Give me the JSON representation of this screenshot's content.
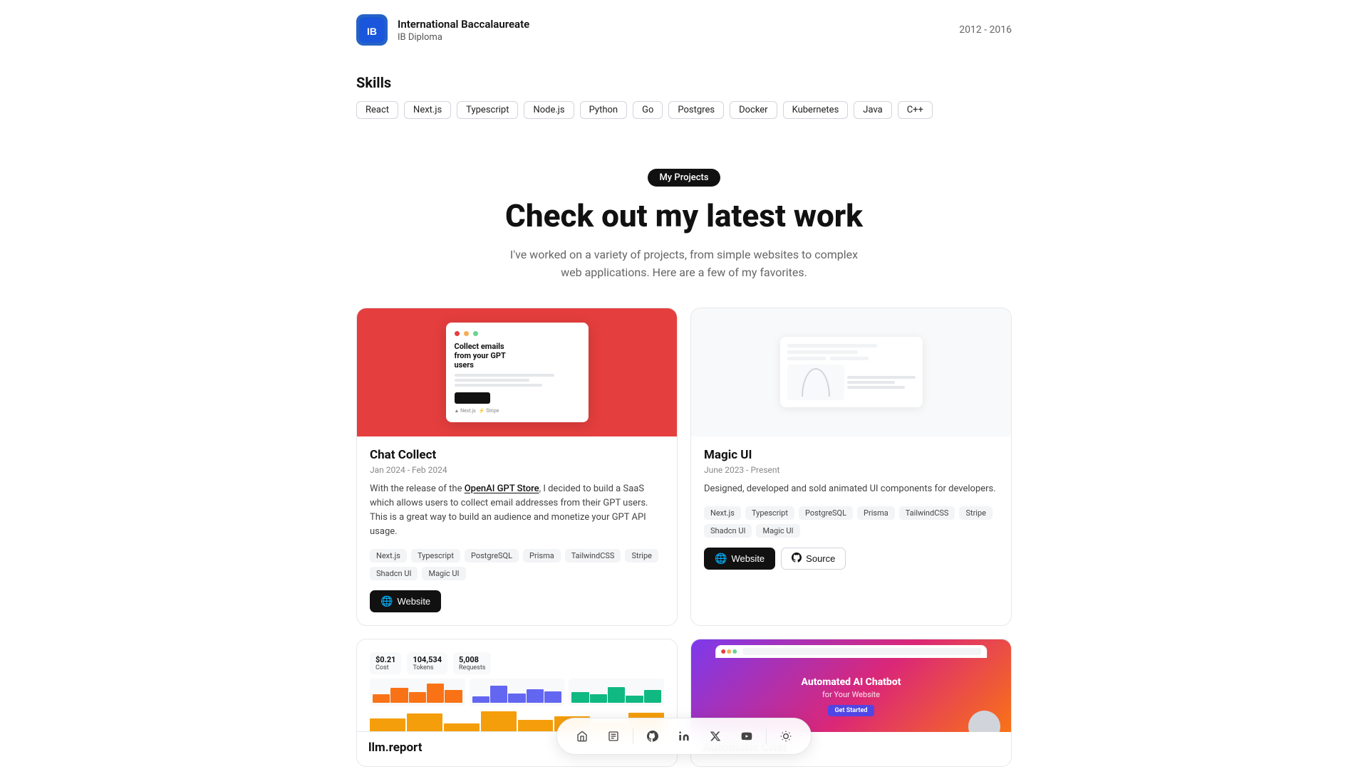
{
  "education": {
    "org_name": "International Baccalaureate",
    "org_short": "IB",
    "degree": "IB Diploma",
    "dates": "2012 - 2016"
  },
  "skills": {
    "section_title": "Skills",
    "tags": [
      "React",
      "Next.js",
      "Typescript",
      "Node.js",
      "Python",
      "Go",
      "Postgres",
      "Docker",
      "Kubernetes",
      "Java",
      "C++"
    ]
  },
  "projects": {
    "badge": "My Projects",
    "heading": "Check out my latest work",
    "subtext": "I've worked on a variety of projects, from simple websites to complex web applications. Here are a few of my favorites.",
    "items": [
      {
        "id": "chat-collect",
        "title": "Chat Collect",
        "dates": "Jan 2024 - Feb 2024",
        "description": "With the release of the OpenAI GPT Store, I decided to build a SaaS which allows users to collect email addresses from their GPT users. This is a great way to build an audience and monetize your GPT API usage.",
        "link_text": "OpenAI GPT Store",
        "tags": [
          "Next.js",
          "Typescript",
          "PostgreSQL",
          "Prisma",
          "TailwindCSS",
          "Stripe",
          "Shadcn UI",
          "Magic UI"
        ],
        "links": [
          {
            "label": "Website",
            "type": "dark"
          }
        ]
      },
      {
        "id": "magic-ui",
        "title": "Magic UI",
        "dates": "June 2023 - Present",
        "description": "Designed, developed and sold animated UI components for developers.",
        "tags": [
          "Next.js",
          "Typescript",
          "PostgreSQL",
          "Prisma",
          "TailwindCSS",
          "Stripe",
          "Shadcn UI",
          "Magic UI"
        ],
        "links": [
          {
            "label": "Website",
            "type": "dark"
          },
          {
            "label": "Source",
            "type": "outline"
          }
        ]
      },
      {
        "id": "bottom-left",
        "title": "llm.report",
        "dates": "",
        "description": "",
        "tags": [],
        "links": []
      },
      {
        "id": "bottom-right",
        "title": "Automatic Chat",
        "dates": "",
        "description": "",
        "tags": [],
        "links": []
      }
    ]
  },
  "navbar": {
    "items": [
      {
        "id": "home",
        "icon": "🏠",
        "label": "Home"
      },
      {
        "id": "resume",
        "icon": "📄",
        "label": "Resume"
      },
      {
        "id": "github",
        "icon": "github",
        "label": "GitHub"
      },
      {
        "id": "linkedin",
        "icon": "linkedin",
        "label": "LinkedIn"
      },
      {
        "id": "twitter",
        "icon": "twitter",
        "label": "Twitter"
      },
      {
        "id": "youtube",
        "icon": "youtube",
        "label": "YouTube"
      },
      {
        "id": "theme",
        "icon": "☀",
        "label": "Toggle Theme"
      }
    ]
  },
  "bottom_cards": {
    "right_title": "Automated AI Chatbot",
    "right_subtitle": "for Your Website"
  }
}
